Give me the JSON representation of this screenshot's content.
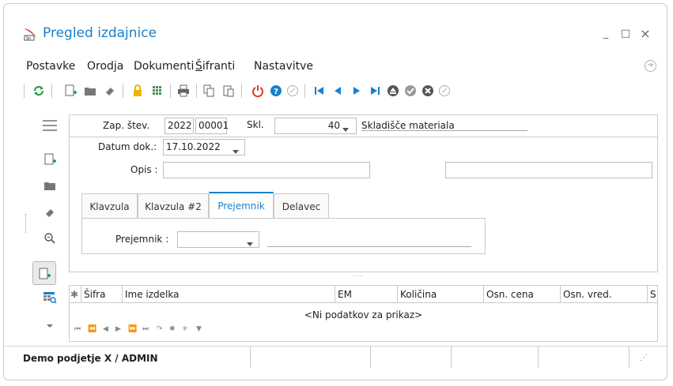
{
  "window": {
    "title": "Pregled izdajnice",
    "controls": {
      "minimize": "_",
      "maximize": "□",
      "close": "×"
    }
  },
  "menu": {
    "items": [
      "Postavke",
      "Orodja",
      "Dokumenti",
      "Šifranti",
      "Nastavitve"
    ]
  },
  "colors": {
    "accent": "#1a7fc9",
    "refresh": "#2e9d4a",
    "power": "#e0362c",
    "gold": "#f0b400"
  },
  "form": {
    "zap_label": "Zap. štev.",
    "zap_year": "2022",
    "zap_num": "00001",
    "skl_label": "Skl.",
    "skl_value": "40",
    "skl_name": "Skladišče materiala",
    "datum_label": "Datum dok.:",
    "datum_value": "17.10.2022",
    "opis_label": "Opis :",
    "opis_value": "",
    "opis2_value": ""
  },
  "tabs": [
    {
      "label": "Klavzula",
      "active": false
    },
    {
      "label": "Klavzula #2",
      "active": false
    },
    {
      "label": "Prejemnik",
      "active": true
    },
    {
      "label": "Delavec",
      "active": false
    }
  ],
  "prejemnik": {
    "label": "Prejemnik :",
    "value": "",
    "name": ""
  },
  "splitter": "……",
  "grid": {
    "columns": [
      "Šifra",
      "Ime izdelka",
      "EM",
      "Količina",
      "Osn. cena",
      "Osn. vred.",
      "S"
    ],
    "rows": [],
    "empty_text": "<Ni podatkov za prikaz>"
  },
  "status": {
    "company": "Demo podjetje X / ADMIN"
  }
}
